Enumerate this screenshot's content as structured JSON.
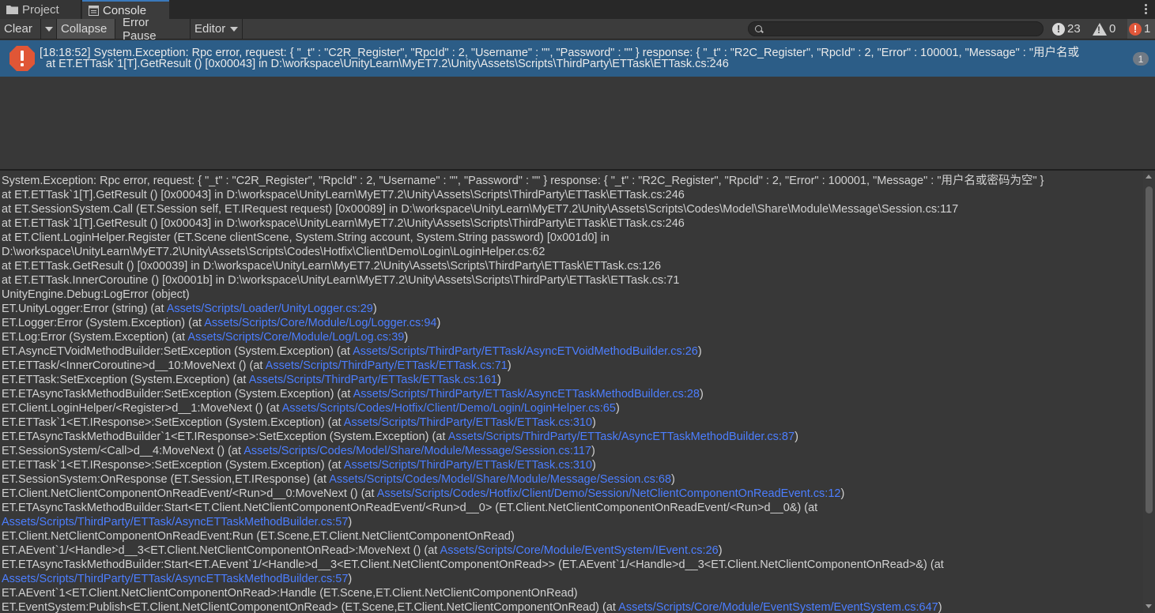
{
  "tabs": {
    "project": "Project",
    "console": "Console"
  },
  "toolbar": {
    "clear": "Clear",
    "collapse": "Collapse",
    "error_pause": "Error Pause",
    "editor": "Editor",
    "log_count": "23",
    "warning_count": "0",
    "error_count": "1",
    "accent_color": "#3a79bb"
  },
  "selected_entry": {
    "line1": "[18:18:52] System.Exception: Rpc error, request: { \"_t\" : \"C2R_Register\", \"RpcId\" : 2, \"Username\" : \"\", \"Password\" : \"\" } response: { \"_t\" : \"R2C_Register\", \"RpcId\" : 2, \"Error\" : 100001, \"Message\" : \"用户名或",
    "line2": "at ET.ETTask`1[T].GetResult () [0x00043] in D:\\workspace\\UnityLearn\\MyET7.2\\Unity\\Assets\\Scripts\\ThirdParty\\ETTask\\ETTask.cs:246",
    "count": "1"
  },
  "stack": [
    {
      "t": "System.Exception: Rpc error, request: { \"_t\" : \"C2R_Register\", \"RpcId\" : 2, \"Username\" : \"\", \"Password\" : \"\" } response: { \"_t\" : \"R2C_Register\", \"RpcId\" : 2, \"Error\" : 100001, \"Message\" : \"用户名或密码为空\" }",
      "l": "",
      "s": ""
    },
    {
      "t": "  at ET.ETTask`1[T].GetResult () [0x00043] in D:\\workspace\\UnityLearn\\MyET7.2\\Unity\\Assets\\Scripts\\ThirdParty\\ETTask\\ETTask.cs:246",
      "l": "",
      "s": ""
    },
    {
      "t": "  at ET.SessionSystem.Call (ET.Session self, ET.IRequest request) [0x00089] in D:\\workspace\\UnityLearn\\MyET7.2\\Unity\\Assets\\Scripts\\Codes\\Model\\Share\\Module\\Message\\Session.cs:117",
      "l": "",
      "s": ""
    },
    {
      "t": "  at ET.ETTask`1[T].GetResult () [0x00043] in D:\\workspace\\UnityLearn\\MyET7.2\\Unity\\Assets\\Scripts\\ThirdParty\\ETTask\\ETTask.cs:246",
      "l": "",
      "s": ""
    },
    {
      "t": "  at ET.Client.LoginHelper.Register (ET.Scene clientScene, System.String account, System.String password) [0x001d0] in",
      "l": "",
      "s": ""
    },
    {
      "t": "D:\\workspace\\UnityLearn\\MyET7.2\\Unity\\Assets\\Scripts\\Codes\\Hotfix\\Client\\Demo\\Login\\LoginHelper.cs:62",
      "l": "",
      "s": ""
    },
    {
      "t": "  at ET.ETTask.GetResult () [0x00039] in D:\\workspace\\UnityLearn\\MyET7.2\\Unity\\Assets\\Scripts\\ThirdParty\\ETTask\\ETTask.cs:126",
      "l": "",
      "s": ""
    },
    {
      "t": "  at ET.ETTask.InnerCoroutine () [0x0001b] in D:\\workspace\\UnityLearn\\MyET7.2\\Unity\\Assets\\Scripts\\ThirdParty\\ETTask\\ETTask.cs:71",
      "l": "",
      "s": ""
    },
    {
      "t": "UnityEngine.Debug:LogError (object)",
      "l": "",
      "s": ""
    },
    {
      "t": "ET.UnityLogger:Error (string) (at ",
      "l": "Assets/Scripts/Loader/UnityLogger.cs:29",
      "s": ")"
    },
    {
      "t": "ET.Logger:Error (System.Exception) (at ",
      "l": "Assets/Scripts/Core/Module/Log/Logger.cs:94",
      "s": ")"
    },
    {
      "t": "ET.Log:Error (System.Exception) (at ",
      "l": "Assets/Scripts/Core/Module/Log/Log.cs:39",
      "s": ")"
    },
    {
      "t": "ET.AsyncETVoidMethodBuilder:SetException (System.Exception) (at ",
      "l": "Assets/Scripts/ThirdParty/ETTask/AsyncETVoidMethodBuilder.cs:26",
      "s": ")"
    },
    {
      "t": "ET.ETTask/<InnerCoroutine>d__10:MoveNext () (at ",
      "l": "Assets/Scripts/ThirdParty/ETTask/ETTask.cs:71",
      "s": ")"
    },
    {
      "t": "ET.ETTask:SetException (System.Exception) (at ",
      "l": "Assets/Scripts/ThirdParty/ETTask/ETTask.cs:161",
      "s": ")"
    },
    {
      "t": "ET.ETAsyncTaskMethodBuilder:SetException (System.Exception) (at ",
      "l": "Assets/Scripts/ThirdParty/ETTask/AsyncETTaskMethodBuilder.cs:28",
      "s": ")"
    },
    {
      "t": "ET.Client.LoginHelper/<Register>d__1:MoveNext () (at ",
      "l": "Assets/Scripts/Codes/Hotfix/Client/Demo/Login/LoginHelper.cs:65",
      "s": ")"
    },
    {
      "t": "ET.ETTask`1<ET.IResponse>:SetException (System.Exception) (at ",
      "l": "Assets/Scripts/ThirdParty/ETTask/ETTask.cs:310",
      "s": ")"
    },
    {
      "t": "ET.ETAsyncTaskMethodBuilder`1<ET.IResponse>:SetException (System.Exception) (at ",
      "l": "Assets/Scripts/ThirdParty/ETTask/AsyncETTaskMethodBuilder.cs:87",
      "s": ")"
    },
    {
      "t": "ET.SessionSystem/<Call>d__4:MoveNext () (at ",
      "l": "Assets/Scripts/Codes/Model/Share/Module/Message/Session.cs:117",
      "s": ")"
    },
    {
      "t": "ET.ETTask`1<ET.IResponse>:SetException (System.Exception) (at ",
      "l": "Assets/Scripts/ThirdParty/ETTask/ETTask.cs:310",
      "s": ")"
    },
    {
      "t": "ET.SessionSystem:OnResponse (ET.Session,ET.IResponse) (at ",
      "l": "Assets/Scripts/Codes/Model/Share/Module/Message/Session.cs:68",
      "s": ")"
    },
    {
      "t": "ET.Client.NetClientComponentOnReadEvent/<Run>d__0:MoveNext () (at ",
      "l": "Assets/Scripts/Codes/Hotfix/Client/Demo/Session/NetClientComponentOnReadEvent.cs:12",
      "s": ")"
    },
    {
      "t": "ET.ETAsyncTaskMethodBuilder:Start<ET.Client.NetClientComponentOnReadEvent/<Run>d__0> (ET.Client.NetClientComponentOnReadEvent/<Run>d__0&) (at",
      "l": "",
      "s": ""
    },
    {
      "t": "",
      "l": "Assets/Scripts/ThirdParty/ETTask/AsyncETTaskMethodBuilder.cs:57",
      "s": ")"
    },
    {
      "t": "ET.Client.NetClientComponentOnReadEvent:Run (ET.Scene,ET.Client.NetClientComponentOnRead)",
      "l": "",
      "s": ""
    },
    {
      "t": "ET.AEvent`1/<Handle>d__3<ET.Client.NetClientComponentOnRead>:MoveNext () (at ",
      "l": "Assets/Scripts/Core/Module/EventSystem/IEvent.cs:26",
      "s": ")"
    },
    {
      "t": "ET.ETAsyncTaskMethodBuilder:Start<ET.AEvent`1/<Handle>d__3<ET.Client.NetClientComponentOnRead>> (ET.AEvent`1/<Handle>d__3<ET.Client.NetClientComponentOnRead>&) (at",
      "l": "",
      "s": ""
    },
    {
      "t": "",
      "l": "Assets/Scripts/ThirdParty/ETTask/AsyncETTaskMethodBuilder.cs:57",
      "s": ")"
    },
    {
      "t": "ET.AEvent`1<ET.Client.NetClientComponentOnRead>:Handle (ET.Scene,ET.Client.NetClientComponentOnRead)",
      "l": "",
      "s": ""
    },
    {
      "t": "ET.EventSystem:Publish<ET.Client.NetClientComponentOnRead> (ET.Scene,ET.Client.NetClientComponentOnRead) (at ",
      "l": "Assets/Scripts/Core/Module/EventSystem/EventSystem.cs:647",
      "s": ")"
    }
  ]
}
